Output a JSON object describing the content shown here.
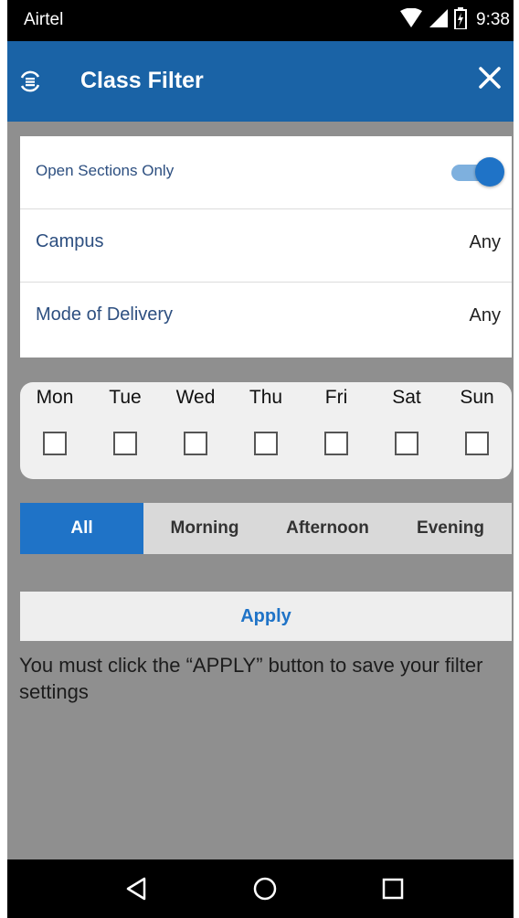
{
  "status_bar": {
    "carrier": "Airtel",
    "time": "9:38",
    "icons": [
      "wifi-icon",
      "signal-icon",
      "battery-icon"
    ]
  },
  "app_bar": {
    "title": "Class Filter",
    "icon": "refresh-list-icon",
    "close_icon": "close-icon"
  },
  "filters": {
    "open_sections": {
      "label": "Open Sections Only",
      "enabled": true
    },
    "campus": {
      "label": "Campus",
      "value": "Any"
    },
    "mode_of_delivery": {
      "label": "Mode of Delivery",
      "value": "Any"
    }
  },
  "days": [
    {
      "label": "Mon",
      "checked": false
    },
    {
      "label": "Tue",
      "checked": false
    },
    {
      "label": "Wed",
      "checked": false
    },
    {
      "label": "Thu",
      "checked": false
    },
    {
      "label": "Fri",
      "checked": false
    },
    {
      "label": "Sat",
      "checked": false
    },
    {
      "label": "Sun",
      "checked": false
    }
  ],
  "time_of_day": {
    "options": [
      "All",
      "Morning",
      "Afternoon",
      "Evening"
    ],
    "selected": "All"
  },
  "apply": {
    "label": "Apply",
    "note": "You must click the “APPLY” button to save your filter settings"
  },
  "nav_bar": {
    "buttons": [
      "back-icon",
      "home-icon",
      "recents-icon"
    ]
  },
  "colors": {
    "accent": "#1f73c7",
    "app_bar": "#1a63a6",
    "background": "#8f8f8f",
    "label_text": "#2d4f80"
  }
}
